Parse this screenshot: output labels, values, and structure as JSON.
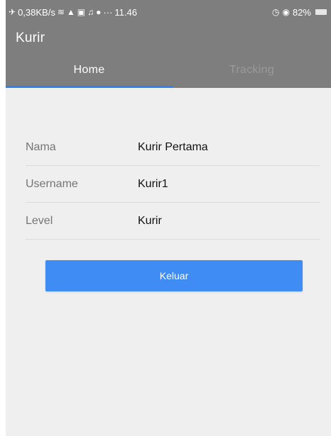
{
  "status_bar": {
    "speed": "0,38KB/s",
    "dots": "···",
    "time": "11.46",
    "battery": "82%"
  },
  "app": {
    "title": "Kurir"
  },
  "tabs": [
    {
      "label": "Home",
      "active": true
    },
    {
      "label": "Tracking",
      "active": false
    }
  ],
  "profile": {
    "rows": [
      {
        "label": "Nama",
        "value": "Kurir Pertama"
      },
      {
        "label": "Username",
        "value": "Kurir1"
      },
      {
        "label": "Level",
        "value": "Kurir"
      }
    ]
  },
  "logout_button": {
    "label": "Keluar"
  },
  "colors": {
    "app_bar": "#7e7e7e",
    "accent": "#2f80f2",
    "button": "#3f8cf5",
    "background": "#efefef"
  }
}
